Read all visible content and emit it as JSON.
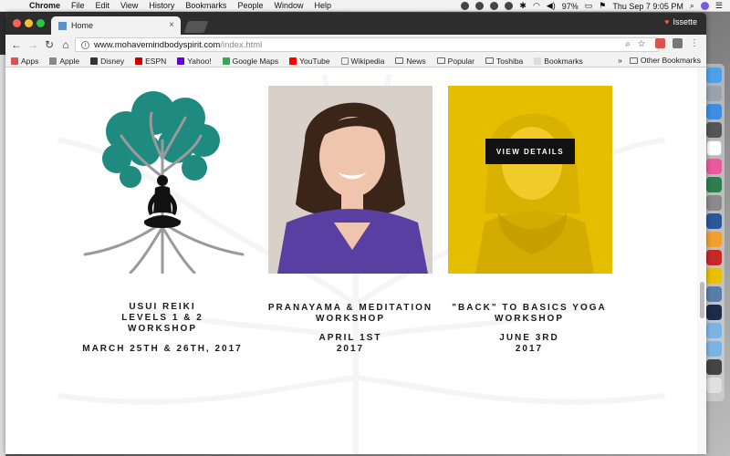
{
  "menubar": {
    "app_name": "Chrome",
    "items": [
      "File",
      "Edit",
      "View",
      "History",
      "Bookmarks",
      "People",
      "Window",
      "Help"
    ],
    "battery": "97%",
    "clock": "Thu Sep 7  9:05 PM"
  },
  "browser": {
    "tab_title": "Home",
    "profile_name": "Issette",
    "url_host": "www.mohavemindbodyspirit.com",
    "url_path": "/index.html",
    "bookmarks": [
      {
        "label": "Apps",
        "icon": "apps-icon",
        "color": "#d9534f"
      },
      {
        "label": "Apple",
        "icon": "apple-icon",
        "color": "#888888"
      },
      {
        "label": "Disney",
        "icon": "disney-icon",
        "color": "#333333"
      },
      {
        "label": "ESPN",
        "icon": "espn-icon",
        "color": "#cc0000"
      },
      {
        "label": "Yahoo!",
        "icon": "yahoo-icon",
        "color": "#5f01d1"
      },
      {
        "label": "Google Maps",
        "icon": "maps-icon",
        "color": "#34a853"
      },
      {
        "label": "YouTube",
        "icon": "youtube-icon",
        "color": "#ff0000"
      },
      {
        "label": "Wikipedia",
        "icon": "wikipedia-icon",
        "color": "#ffffff"
      },
      {
        "label": "News",
        "icon": "folder-icon",
        "color": "#dddddd"
      },
      {
        "label": "Popular",
        "icon": "folder-icon",
        "color": "#dddddd"
      },
      {
        "label": "Toshiba",
        "icon": "folder-icon",
        "color": "#dddddd"
      },
      {
        "label": "Bookmarks",
        "icon": "bookmark-icon",
        "color": "#dddddd"
      }
    ],
    "overflow_label": "»",
    "other_bookmarks": "Other Bookmarks"
  },
  "workshops": [
    {
      "title_lines": [
        "USUI REIKI",
        "LEVELS 1 & 2",
        "WORKSHOP"
      ],
      "date_lines": [
        "MARCH 25TH & 26TH, 2017"
      ]
    },
    {
      "title_lines": [
        "PRANAYAMA & MEDITATION",
        "WORKSHOP"
      ],
      "date_lines": [
        "APRIL 1ST",
        "2017"
      ]
    },
    {
      "title_lines": [
        "\"BACK\" TO BASICS YOGA",
        "WORKSHOP"
      ],
      "date_lines": [
        "JUNE 3RD",
        "2017"
      ]
    }
  ],
  "overlay": {
    "view_details": "VIEW DETAILS"
  },
  "colors": {
    "accent_yellow": "#e8c000",
    "tree_teal": "#1f8a80",
    "purple_shirt": "#5a3fa3"
  }
}
